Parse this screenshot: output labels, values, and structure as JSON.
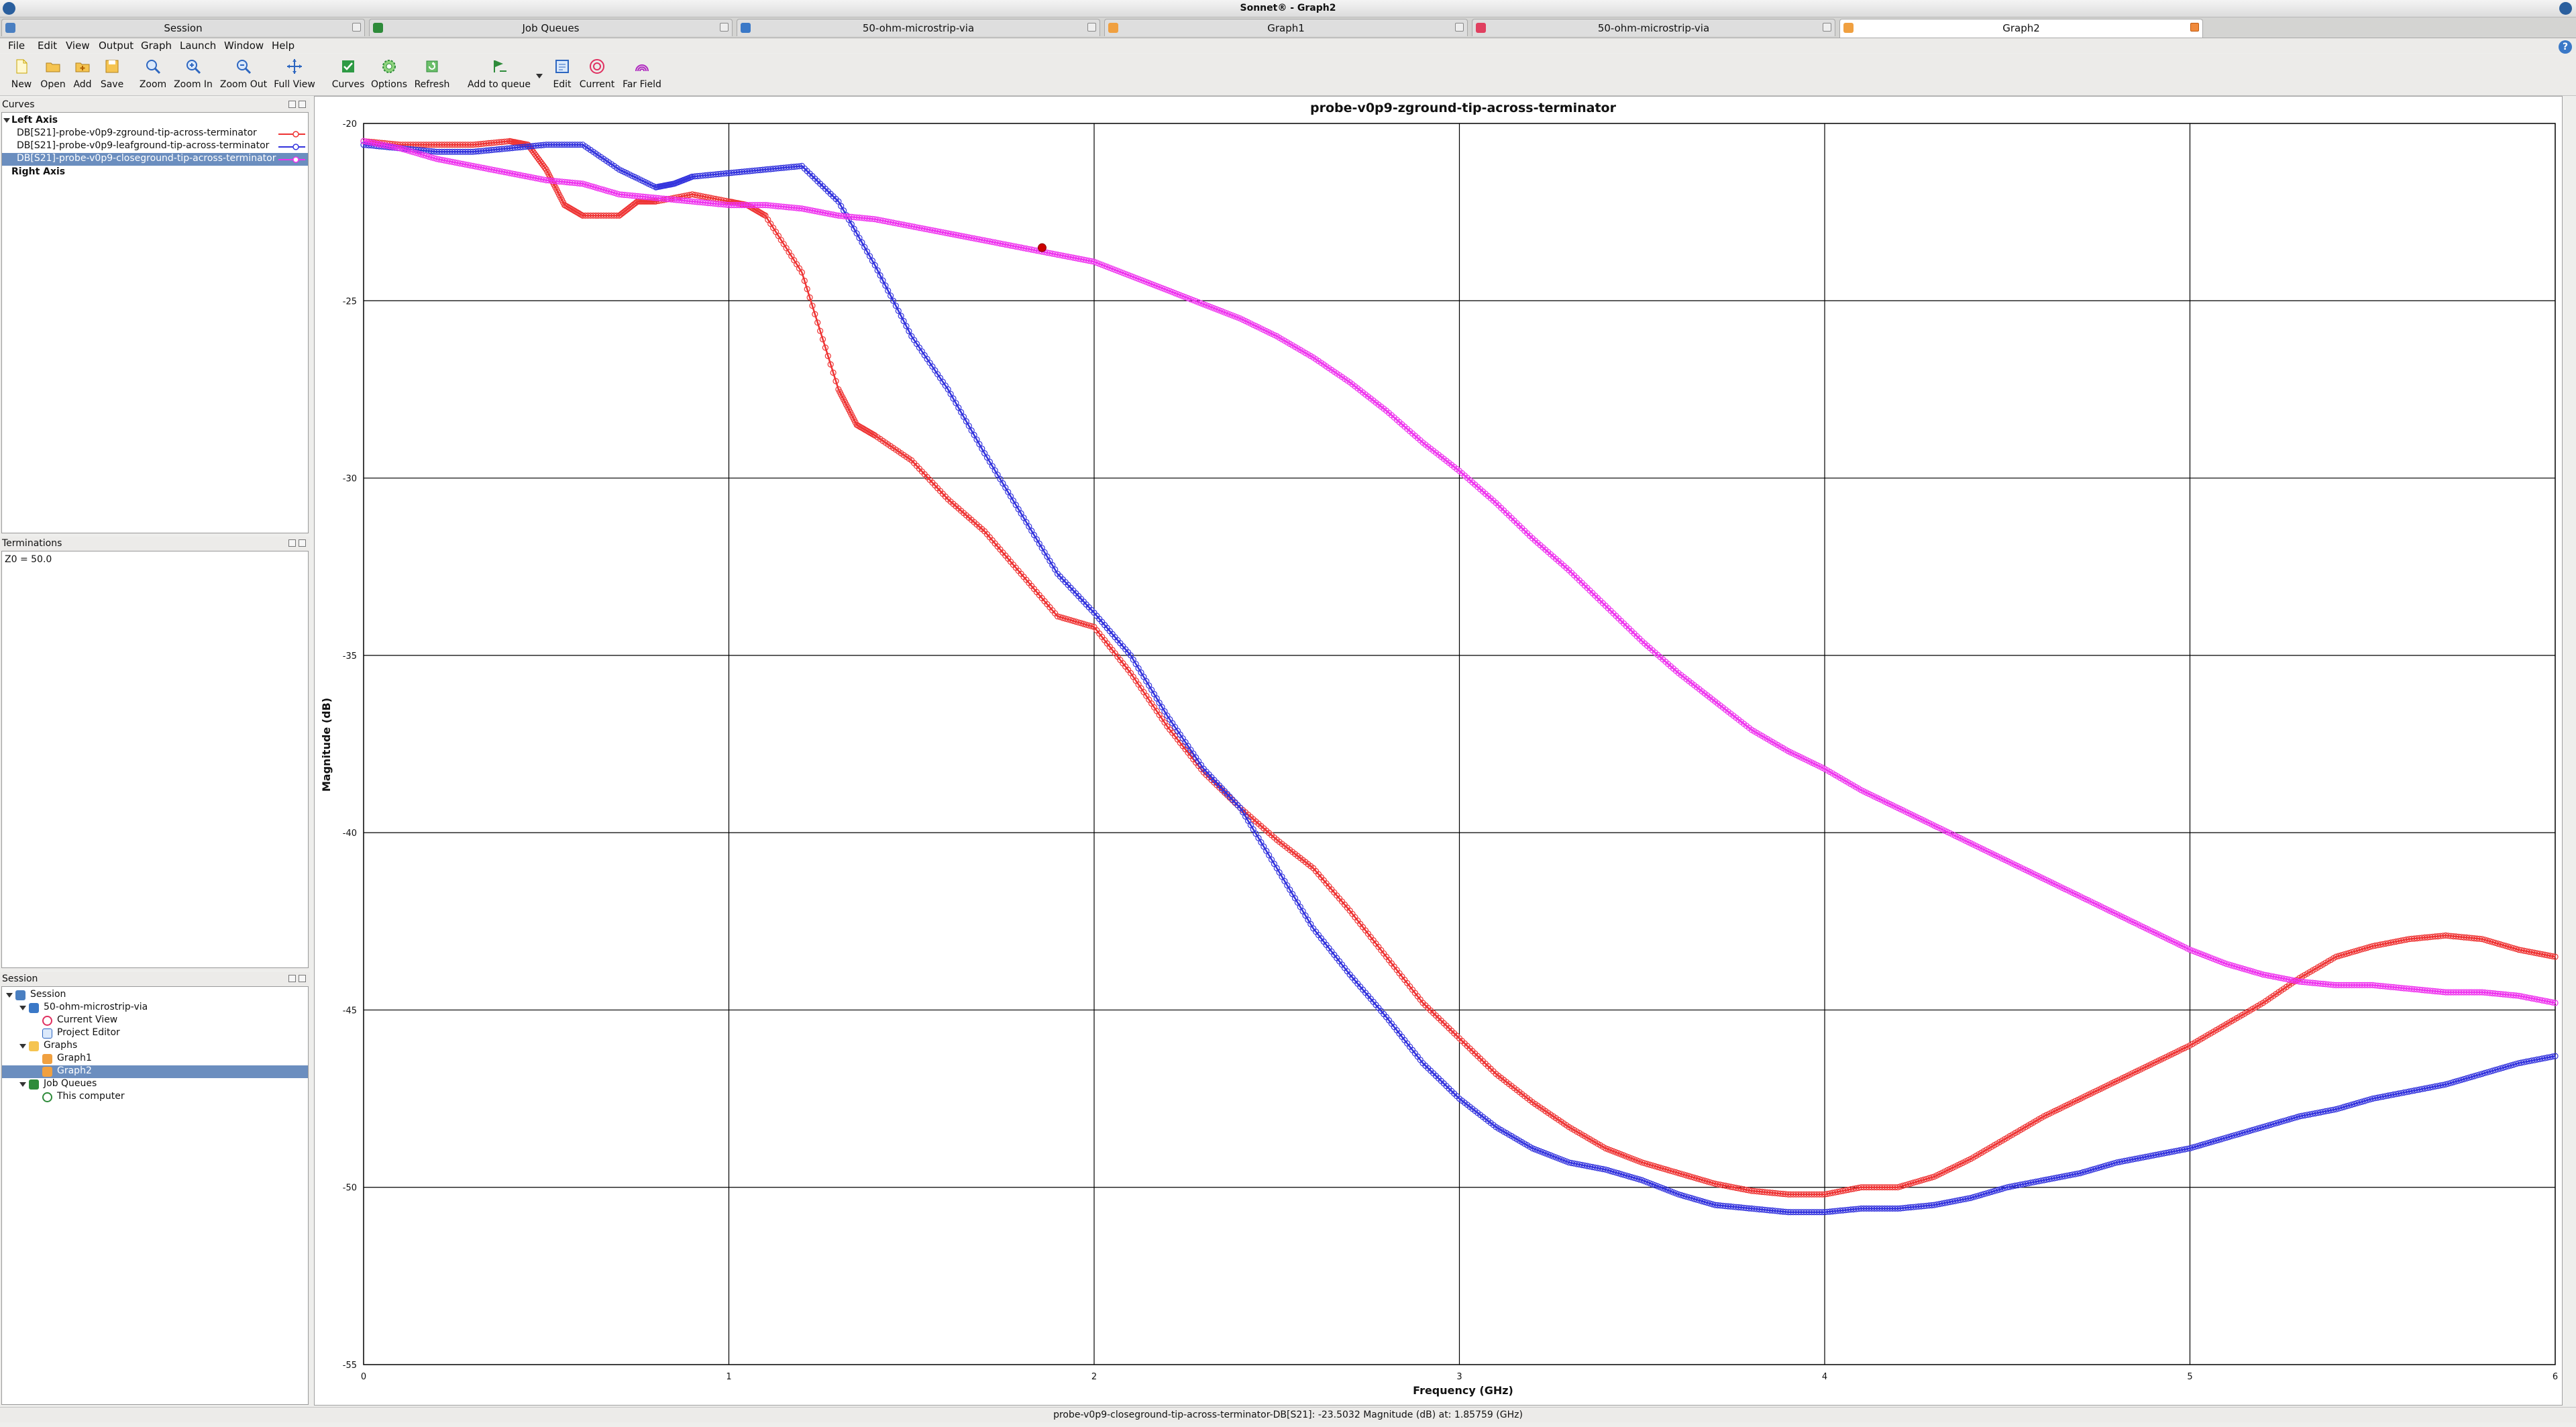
{
  "window": {
    "title": "Sonnet® - Graph2"
  },
  "tabs": [
    {
      "label": "Session",
      "color": "#4a7fc1"
    },
    {
      "label": "Job Queues",
      "color": "#2e8b3a"
    },
    {
      "label": "50-ohm-microstrip-via",
      "color": "#3a78c7"
    },
    {
      "label": "Graph1",
      "color": "#f0a040"
    },
    {
      "label": "50-ohm-microstrip-via",
      "color": "#e04060"
    },
    {
      "label": "Graph2",
      "color": "#f0a040"
    }
  ],
  "menu": [
    "File",
    "Edit",
    "View",
    "Output",
    "Graph",
    "Launch",
    "Window",
    "Help"
  ],
  "toolbar": [
    {
      "label": "New",
      "icon": "new-file-icon"
    },
    {
      "label": "Open",
      "icon": "open-folder-icon"
    },
    {
      "label": "Add",
      "icon": "add-folder-icon"
    },
    {
      "label": "Save",
      "icon": "save-icon"
    },
    {
      "label": "Zoom",
      "icon": "zoom-icon"
    },
    {
      "label": "Zoom In",
      "icon": "zoom-in-icon"
    },
    {
      "label": "Zoom Out",
      "icon": "zoom-out-icon"
    },
    {
      "label": "Full View",
      "icon": "full-view-icon"
    },
    {
      "label": "Curves",
      "icon": "curves-icon"
    },
    {
      "label": "Options",
      "icon": "options-gear-icon"
    },
    {
      "label": "Refresh",
      "icon": "refresh-icon"
    },
    {
      "label": "Add to queue",
      "icon": "add-to-queue-icon"
    },
    {
      "label": "Edit",
      "icon": "edit-icon"
    },
    {
      "label": "Current",
      "icon": "current-icon"
    },
    {
      "label": "Far Field",
      "icon": "far-field-icon"
    }
  ],
  "curves_panel": {
    "title": "Curves",
    "left_axis_label": "Left Axis",
    "right_axis_label": "Right Axis",
    "items": [
      {
        "label": "DB[S21]-probe-v0p9-zground-tip-across-terminator",
        "color": "#ee3333",
        "selected": false
      },
      {
        "label": "DB[S21]-probe-v0p9-leafground-tip-across-terminator",
        "color": "#3333dd",
        "selected": false
      },
      {
        "label": "DB[S21]-probe-v0p9-closeground-tip-across-terminator",
        "color": "#ee33ee",
        "selected": true
      }
    ]
  },
  "terminations_panel": {
    "title": "Terminations",
    "text": "Z0 = 50.0"
  },
  "session_panel": {
    "title": "Session",
    "tree": [
      {
        "label": "Session",
        "level": 0,
        "expanded": true,
        "icon": "session-icon",
        "selected": false
      },
      {
        "label": "50-ohm-microstrip-via",
        "level": 1,
        "expanded": true,
        "icon": "project-icon",
        "selected": false
      },
      {
        "label": "Current View",
        "level": 2,
        "icon": "current-view-icon",
        "selected": false
      },
      {
        "label": "Project Editor",
        "level": 2,
        "icon": "project-editor-icon",
        "selected": false
      },
      {
        "label": "Graphs",
        "level": 1,
        "expanded": true,
        "icon": "graphs-folder-icon",
        "selected": false
      },
      {
        "label": "Graph1",
        "level": 2,
        "icon": "graph-icon",
        "selected": false
      },
      {
        "label": "Graph2",
        "level": 2,
        "icon": "graph-icon",
        "selected": true
      },
      {
        "label": "Job Queues",
        "level": 1,
        "expanded": true,
        "icon": "job-queues-icon",
        "selected": false
      },
      {
        "label": "This computer",
        "level": 2,
        "icon": "computer-check-icon",
        "selected": false
      }
    ]
  },
  "status": "probe-v0p9-closeground-tip-across-terminator-DB[S21]: -23.5032 Magnitude (dB) at: 1.85759 (GHz)",
  "chart_data": {
    "type": "line",
    "title": "probe-v0p9-zground-tip-across-terminator",
    "xlabel": "Frequency (GHz)",
    "ylabel": "Magnitude (dB)",
    "xlim": [
      0,
      6
    ],
    "ylim": [
      -55,
      -20
    ],
    "xticks": [
      0,
      1,
      2,
      3,
      4,
      5,
      6
    ],
    "yticks": [
      -20,
      -25,
      -30,
      -35,
      -40,
      -45,
      -50,
      -55
    ],
    "grid": true,
    "marker": {
      "series": 2,
      "x": 1.85759,
      "y": -23.5032,
      "color": "#cc0000"
    },
    "series": [
      {
        "name": "DB[S21]-probe-v0p9-zground-tip-across-terminator",
        "color": "#ee3333",
        "x": [
          0,
          0.1,
          0.2,
          0.3,
          0.4,
          0.45,
          0.5,
          0.55,
          0.6,
          0.7,
          0.75,
          0.8,
          0.9,
          1.0,
          1.05,
          1.1,
          1.2,
          1.3,
          1.35,
          1.4,
          1.5,
          1.6,
          1.7,
          1.8,
          1.9,
          2.0,
          2.1,
          2.2,
          2.3,
          2.4,
          2.5,
          2.6,
          2.7,
          2.8,
          2.9,
          3.0,
          3.1,
          3.2,
          3.3,
          3.4,
          3.5,
          3.6,
          3.7,
          3.8,
          3.9,
          4.0,
          4.1,
          4.2,
          4.3,
          4.4,
          4.5,
          4.6,
          4.7,
          4.8,
          4.9,
          5.0,
          5.1,
          5.2,
          5.3,
          5.4,
          5.5,
          5.6,
          5.7,
          5.8,
          5.9,
          6.0
        ],
        "y": [
          -20.5,
          -20.6,
          -20.6,
          -20.6,
          -20.5,
          -20.6,
          -21.3,
          -22.3,
          -22.6,
          -22.6,
          -22.2,
          -22.2,
          -22.0,
          -22.2,
          -22.3,
          -22.6,
          -24.2,
          -27.5,
          -28.5,
          -28.8,
          -29.5,
          -30.6,
          -31.5,
          -32.7,
          -33.9,
          -34.2,
          -35.5,
          -37.0,
          -38.3,
          -39.3,
          -40.2,
          -41.0,
          -42.2,
          -43.5,
          -44.8,
          -45.8,
          -46.8,
          -47.6,
          -48.3,
          -48.9,
          -49.3,
          -49.6,
          -49.9,
          -50.1,
          -50.2,
          -50.2,
          -50.0,
          -50.0,
          -49.7,
          -49.2,
          -48.6,
          -48.0,
          -47.5,
          -47.0,
          -46.5,
          -46.0,
          -45.4,
          -44.8,
          -44.1,
          -43.5,
          -43.2,
          -43.0,
          -42.9,
          -43.0,
          -43.3,
          -43.5
        ]
      },
      {
        "name": "DB[S21]-probe-v0p9-leafground-tip-across-terminator",
        "color": "#3333dd",
        "x": [
          0,
          0.1,
          0.2,
          0.3,
          0.4,
          0.5,
          0.6,
          0.7,
          0.8,
          0.85,
          0.9,
          1.0,
          1.1,
          1.2,
          1.3,
          1.4,
          1.5,
          1.6,
          1.7,
          1.8,
          1.9,
          2.0,
          2.1,
          2.2,
          2.3,
          2.4,
          2.5,
          2.6,
          2.7,
          2.8,
          2.9,
          3.0,
          3.1,
          3.2,
          3.3,
          3.4,
          3.5,
          3.6,
          3.7,
          3.8,
          3.9,
          4.0,
          4.1,
          4.2,
          4.3,
          4.4,
          4.5,
          4.6,
          4.7,
          4.8,
          4.9,
          5.0,
          5.1,
          5.2,
          5.3,
          5.4,
          5.5,
          5.6,
          5.7,
          5.8,
          5.9,
          6.0
        ],
        "y": [
          -20.6,
          -20.7,
          -20.8,
          -20.8,
          -20.7,
          -20.6,
          -20.6,
          -21.3,
          -21.8,
          -21.7,
          -21.5,
          -21.4,
          -21.3,
          -21.2,
          -22.2,
          -24.0,
          -26.0,
          -27.5,
          -29.3,
          -31.0,
          -32.7,
          -33.8,
          -35.0,
          -36.7,
          -38.2,
          -39.3,
          -41.0,
          -42.7,
          -44.0,
          -45.2,
          -46.5,
          -47.5,
          -48.3,
          -48.9,
          -49.3,
          -49.5,
          -49.8,
          -50.2,
          -50.5,
          -50.6,
          -50.7,
          -50.7,
          -50.6,
          -50.6,
          -50.5,
          -50.3,
          -50.0,
          -49.8,
          -49.6,
          -49.3,
          -49.1,
          -48.9,
          -48.6,
          -48.3,
          -48.0,
          -47.8,
          -47.5,
          -47.3,
          -47.1,
          -46.8,
          -46.5,
          -46.3
        ]
      },
      {
        "name": "DB[S21]-probe-v0p9-closeground-tip-across-terminator",
        "color": "#ee33ee",
        "x": [
          0,
          0.1,
          0.2,
          0.3,
          0.4,
          0.5,
          0.6,
          0.7,
          0.8,
          0.9,
          1.0,
          1.1,
          1.2,
          1.3,
          1.4,
          1.5,
          1.6,
          1.7,
          1.8,
          1.9,
          2.0,
          2.1,
          2.2,
          2.3,
          2.4,
          2.5,
          2.6,
          2.7,
          2.8,
          2.9,
          3.0,
          3.1,
          3.2,
          3.3,
          3.4,
          3.5,
          3.6,
          3.7,
          3.8,
          3.9,
          4.0,
          4.1,
          4.2,
          4.3,
          4.4,
          4.5,
          4.6,
          4.7,
          4.8,
          4.9,
          5.0,
          5.1,
          5.2,
          5.3,
          5.4,
          5.5,
          5.6,
          5.7,
          5.8,
          5.9,
          6.0
        ],
        "y": [
          -20.5,
          -20.7,
          -21.0,
          -21.2,
          -21.4,
          -21.6,
          -21.7,
          -22.0,
          -22.1,
          -22.2,
          -22.3,
          -22.3,
          -22.4,
          -22.6,
          -22.7,
          -22.9,
          -23.1,
          -23.3,
          -23.5,
          -23.7,
          -23.9,
          -24.3,
          -24.7,
          -25.1,
          -25.5,
          -26.0,
          -26.6,
          -27.3,
          -28.1,
          -29.0,
          -29.8,
          -30.7,
          -31.7,
          -32.6,
          -33.6,
          -34.6,
          -35.5,
          -36.3,
          -37.1,
          -37.7,
          -38.2,
          -38.8,
          -39.3,
          -39.8,
          -40.3,
          -40.8,
          -41.3,
          -41.8,
          -42.3,
          -42.8,
          -43.3,
          -43.7,
          -44.0,
          -44.2,
          -44.3,
          -44.3,
          -44.4,
          -44.5,
          -44.5,
          -44.6,
          -44.8
        ]
      }
    ]
  }
}
